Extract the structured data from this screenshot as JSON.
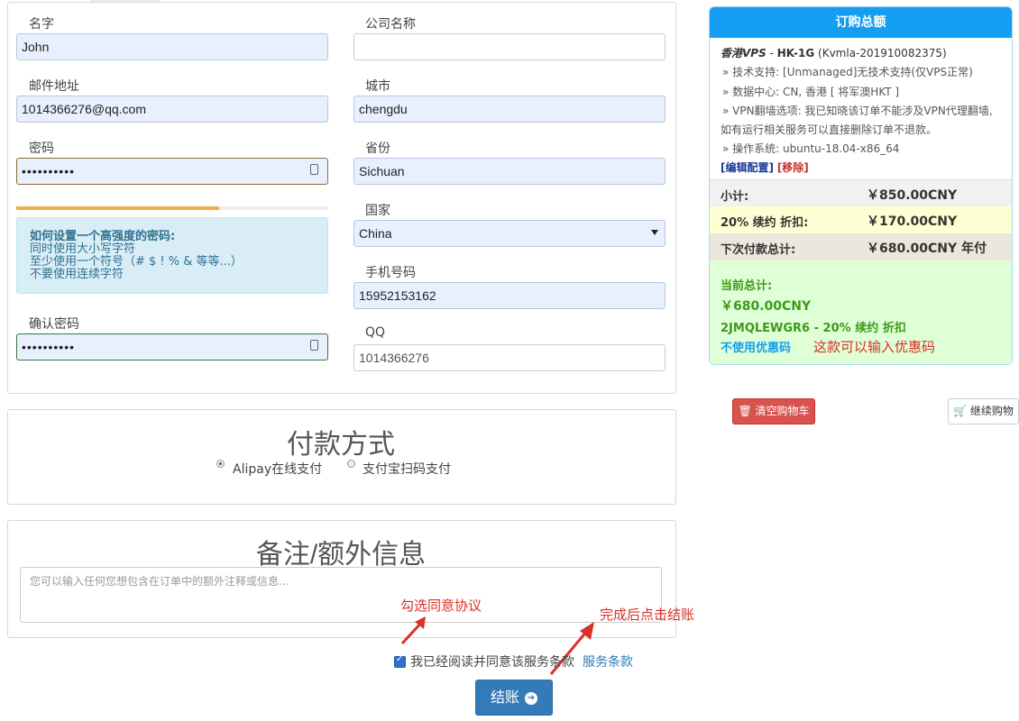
{
  "form": {
    "name_label": "名字",
    "name_value": "John",
    "company_label": "公司名称",
    "company_value": "",
    "email_label": "邮件地址",
    "email_value": "1014366276@qq.com",
    "city_label": "城市",
    "city_value": "chengdu",
    "password_label": "密码",
    "password_value": "••••••••••",
    "province_label": "省份",
    "province_value": "Sichuan",
    "country_label": "国家",
    "country_value": "China",
    "password_strength_percent": 65,
    "tip_title": "如何设置一个高强度的密码:",
    "tip_line1": "同时使用大小写字符",
    "tip_line2": "至少使用一个符号（# $ ! % & 等等...）",
    "tip_line3": "不要使用连续字符",
    "phone_label": "手机号码",
    "phone_value": "15952153162",
    "confirm_label": "确认密码",
    "confirm_value": "••••••••••",
    "qq_label": "QQ",
    "qq_value": "1014366276"
  },
  "payment": {
    "title": "付款方式",
    "option1": "Alipay在线支付",
    "option2": "支付宝扫码支付",
    "selected": "Alipay在线支付"
  },
  "notes": {
    "title": "备注/额外信息",
    "placeholder": "您可以输入任何您想包含在订单中的额外注释或信息..."
  },
  "agree": {
    "text": "我已经阅读并同意该服务条款",
    "link": "服务条款",
    "checked": true
  },
  "checkout_label": "结账",
  "annotations": {
    "agree_hint": "勾选同意协议",
    "checkout_hint": "完成后点击结账",
    "coupon_hint": "这款可以输入优惠码"
  },
  "summary": {
    "title": "订购总额",
    "product_group": "香港VPS",
    "product_sep": " - ",
    "product_name": "HK-1G",
    "product_id": "(Kvmla-201910082375)",
    "line_support": "» 技术支持: [Unmanaged]无技术支持(仅VPS正常)",
    "line_datacenter": "» 数据中心: CN, 香港 [ 将军澳HKT ]",
    "line_vpn1": "» VPN翻墙选项: 我已知晓该订单不能涉及VPN代理翻墙,",
    "line_vpn2": "如有运行相关服务可以直接删除订单不退款。",
    "line_os": "» 操作系统: ubuntu-18.04-x86_64",
    "edit_link": "[编辑配置]",
    "remove_link": "[移除]",
    "subtotal_label": "小计:",
    "subtotal_value": "￥850.00CNY",
    "discount_label": "20% 续约 折扣:",
    "discount_value": "￥170.00CNY",
    "recurring_label": "下次付款总计:",
    "recurring_value": "￥680.00CNY 年付",
    "total_label": "当前总计:",
    "total_value": "￥680.00CNY",
    "promo_text": "2JMQLEWGR6 - 20% 续约 折扣",
    "remove_promo": "不使用优惠码"
  },
  "cart": {
    "clear_label": "清空购物车",
    "continue_label": "继续购物"
  },
  "colors": {
    "primary": "#337ab7",
    "summary_header": "#139ef2",
    "danger": "#d9534f",
    "annotation": "#d9302a",
    "success_bg": "#dfffd6"
  }
}
